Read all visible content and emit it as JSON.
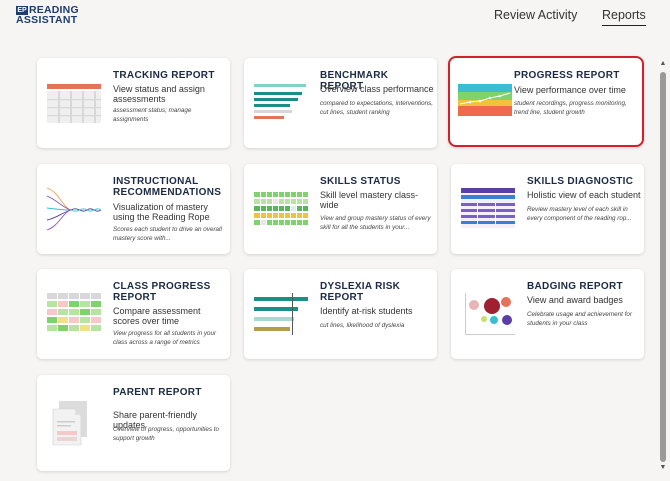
{
  "app": {
    "logo_badge": "EP",
    "logo_top": "READING",
    "logo_bottom": "ASSISTANT"
  },
  "nav": {
    "review": "Review Activity",
    "reports": "Reports"
  },
  "cards": [
    {
      "title": "TRACKING REPORT",
      "subtitle": "View status and assign assessments",
      "desc": "assessment status; manage assignments",
      "icon": "tracking-grid-icon"
    },
    {
      "title": "BENCHMARK REPORT",
      "subtitle": "Overview class performance",
      "desc": "compared to expectations, interventions, cut lines, student ranking",
      "icon": "benchmark-bars-icon"
    },
    {
      "title": "PROGRESS REPORT",
      "subtitle": "View performance over time",
      "desc": "student recordings, progress monitoring, trend line, student growth",
      "icon": "progress-chart-icon"
    },
    {
      "title": "INSTRUCTIONAL RECOMMENDATIONS",
      "subtitle": "Visualization of mastery using the Reading Rope",
      "desc": "Scores each student to drive an overall mastery score with...",
      "icon": "reading-rope-icon"
    },
    {
      "title": "SKILLS STATUS",
      "subtitle": "Skill level mastery class-wide",
      "desc": "View and group mastery status of every skill for all the students in your...",
      "icon": "skills-heatmap-icon"
    },
    {
      "title": "SKILLS DIAGNOSTIC",
      "subtitle": "Holistic view of each student",
      "desc": "Review mastery level of each skill in every component of the reading rop...",
      "icon": "diagnostic-table-icon"
    },
    {
      "title": "CLASS PROGRESS REPORT",
      "subtitle": "Compare assessment scores over time",
      "desc": "View progress for all students in your class across a range of metrics",
      "icon": "class-progress-grid-icon"
    },
    {
      "title": "DYSLEXIA RISK REPORT",
      "subtitle": "Identify at-risk students",
      "desc": "cut lines, likelihood of dyslexia",
      "icon": "dyslexia-bars-icon"
    },
    {
      "title": "BADGING REPORT",
      "subtitle": "View and award badges",
      "desc": "Celebrate usage and achievement for students in your class",
      "icon": "bubble-chart-icon"
    },
    {
      "title": "PARENT REPORT",
      "subtitle": "Share parent-friendly updates",
      "desc": "Overview of progress, opportunities to support growth",
      "icon": "parent-document-icon"
    }
  ],
  "scroll": {
    "up": "▲",
    "down": "▼"
  },
  "colors": {
    "selected_border": "#d0202a",
    "brand_navy": "#1c3d6e"
  }
}
